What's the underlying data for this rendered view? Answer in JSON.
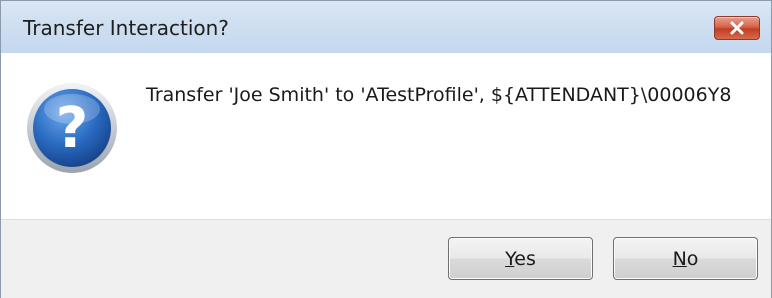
{
  "dialog": {
    "title": "Transfer Interaction?",
    "message": "Transfer 'Joe Smith' to 'ATestProfile', ${ATTENDANT}\\00006Y8",
    "icon": "question-icon",
    "close_icon": "close-icon",
    "colors": {
      "titlebar": "#c4d8ef",
      "close_button": "#c13d23",
      "icon_blue": "#1f5fb0",
      "footer": "#f0f0f0"
    }
  },
  "buttons": {
    "yes": {
      "mnemonic": "Y",
      "rest": "es"
    },
    "no": {
      "mnemonic": "N",
      "rest": "o"
    }
  }
}
